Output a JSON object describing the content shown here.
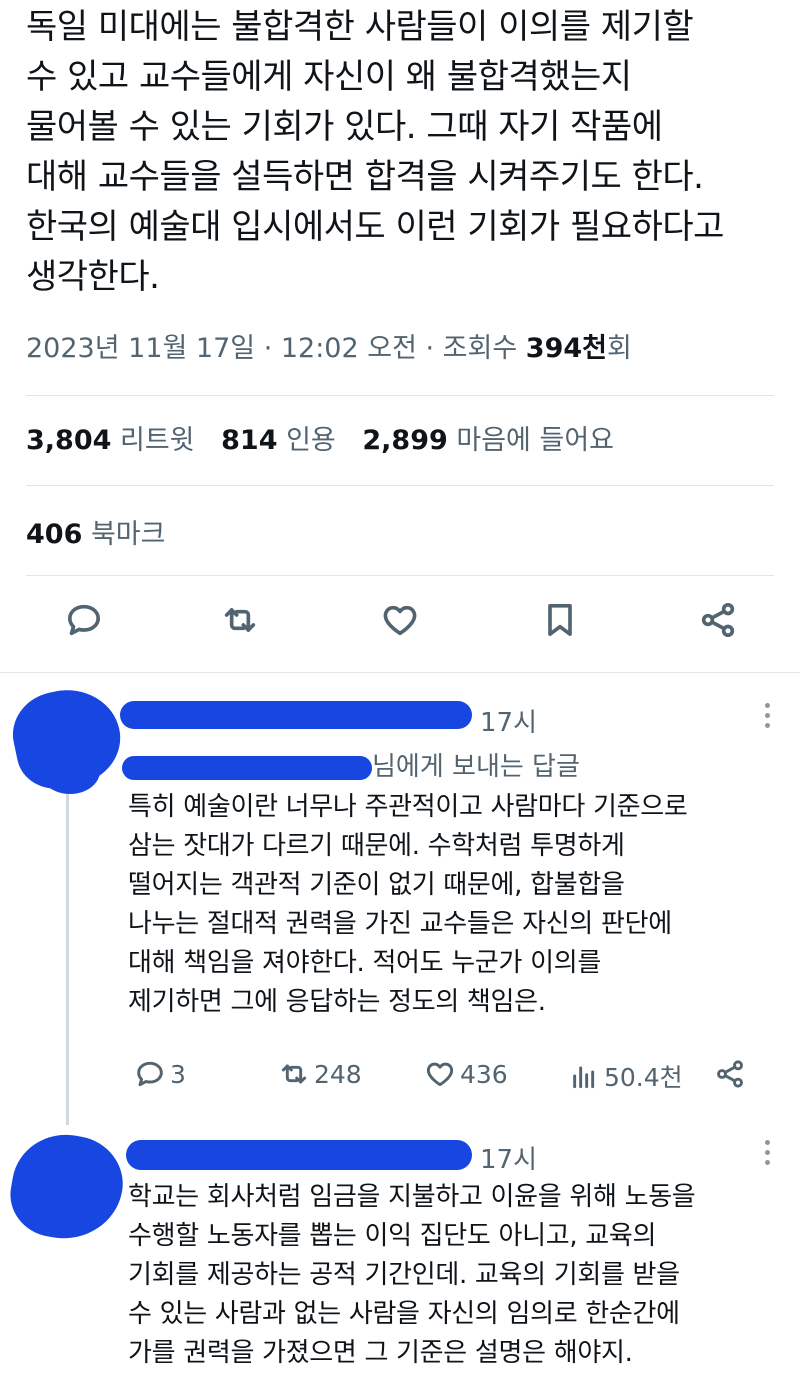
{
  "tweet": {
    "lines": [
      "독일 미대에는 불합격한 사람들이 이의를 제기할",
      "수 있고 교수들에게 자신이 왜 불합격했는지",
      "물어볼 수 있는 기회가 있다.  그때 자기 작품에",
      "대해 교수들을 설득하면 합격을 시켜주기도 한다.",
      "한국의 예술대 입시에서도 이런 기회가 필요하다고",
      "생각한다."
    ],
    "date": "2023년 11월 17일 · 12:02 오전 · 조회수 ",
    "views": "394천",
    "views_suffix": "회"
  },
  "stats": {
    "retweets": "3,804",
    "retweets_label": "리트윗",
    "quotes": "814",
    "quotes_label": "인용",
    "likes": "2,899",
    "likes_label": "마음에 들어요",
    "bookmarks": "406",
    "bookmarks_label": "북마크"
  },
  "actions": [
    "reply-icon",
    "retweet-icon",
    "heart-icon",
    "bookmark-icon",
    "share-icon"
  ],
  "reply1": {
    "time": "17시",
    "replying_to": "님에게 보내는 답글",
    "lines": [
      "특히 예술이란 너무나 주관적이고 사람마다 기준으로",
      "삼는 잣대가 다르기 때문에. 수학처럼 투명하게",
      "떨어지는 객관적 기준이 없기 때문에, 합불합을",
      "나누는 절대적 권력을 가진 교수들은 자신의 판단에",
      "대해 책임을 져야한다. 적어도 누군가 이의를",
      "제기하면 그에 응답하는 정도의 책임은."
    ],
    "replies": "3",
    "retweets": "248",
    "likes": "436",
    "views": "50.4천"
  },
  "reply2": {
    "time": "17시",
    "lines": [
      "학교는 회사처럼 임금을 지불하고 이윤을 위해 노동을",
      "수행할 노동자를 뽑는 이익 집단도 아니고, 교육의",
      "기회를 제공하는 공적 기간인데. 교육의 기회를 받을",
      "수 있는 사람과 없는 사람을 자신의 임의로 한순간에",
      "가를 권력을 가졌으면 그 기준은 설명은 해야지."
    ]
  },
  "colors": {
    "redaction": "#1747e0",
    "muted": "#536471",
    "text": "#0f1419",
    "divider": "#e1e6ea"
  }
}
